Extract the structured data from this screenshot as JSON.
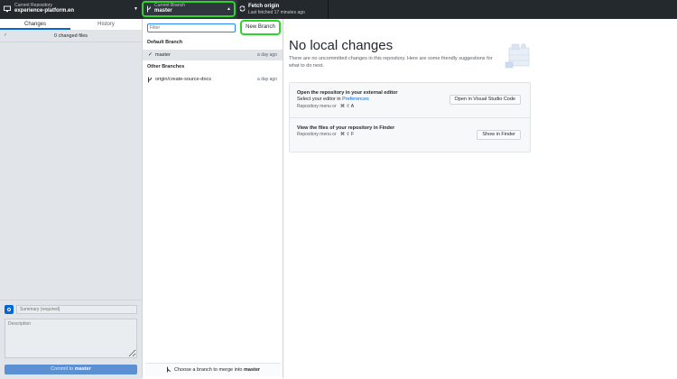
{
  "toolbar": {
    "repo_label": "Current Repository",
    "repo_name": "experience-platform.en",
    "branch_label": "Current Branch",
    "branch_name": "master",
    "fetch_title": "Fetch origin",
    "fetch_sub": "Last fetched 17 minutes ago"
  },
  "sidebar": {
    "tabs": [
      {
        "label": "Changes"
      },
      {
        "label": "History"
      }
    ],
    "changed_files": "0 changed files",
    "summary_placeholder": "Summary (required)",
    "description_placeholder": "Description",
    "commit_prefix": "Commit to",
    "commit_branch": "master",
    "avatar_color": "#0366d6"
  },
  "branch_panel": {
    "filter_placeholder": "Filter",
    "new_branch_label": "New Branch",
    "default_group": "Default Branch",
    "other_group": "Other Branches",
    "branches": [
      {
        "name": "master",
        "age": "a day ago",
        "selected": true
      },
      {
        "name": "origin/create-source-docs",
        "age": "a day ago",
        "selected": false
      }
    ],
    "merge_prefix": "Choose a branch to merge into",
    "merge_branch": "master"
  },
  "main": {
    "title": "No local changes",
    "description": "There are no uncommitted changes in this repository. Here are some friendly suggestions for what to do next.",
    "cards": [
      {
        "title": "Open the repository in your external editor",
        "sub_prefix": "Select your editor in",
        "sub_link": "Preferences",
        "hint": "Repository menu or",
        "keys": "⌘  ⇧  A",
        "button": "Open in Visual Studio Code"
      },
      {
        "title": "View the files of your repository in Finder",
        "sub_prefix": "",
        "sub_link": "",
        "hint": "Repository menu or",
        "keys": "⌘  ⇧  F",
        "button": "Show in Finder"
      }
    ]
  },
  "colors": {
    "toolbar_bg": "#24292e",
    "highlight_green": "#2fd42a",
    "accent_blue": "#0366d6"
  }
}
